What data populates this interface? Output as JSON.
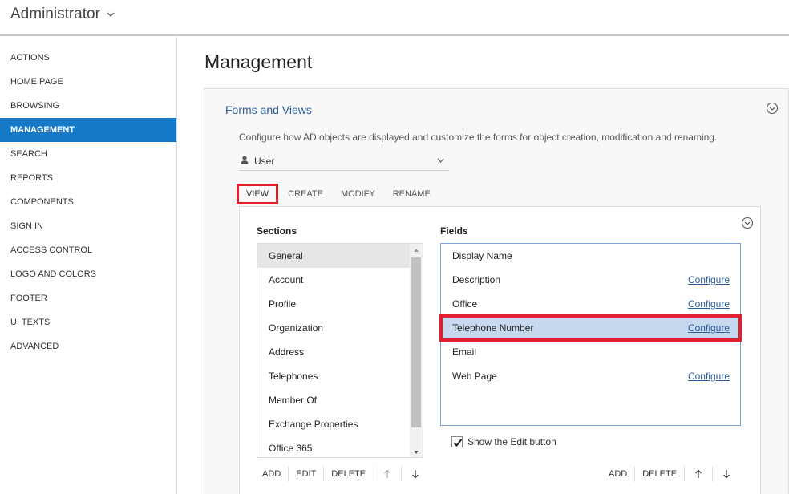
{
  "header": {
    "title": "Administrator"
  },
  "sidebar": {
    "items": [
      {
        "label": "ACTIONS"
      },
      {
        "label": "HOME PAGE"
      },
      {
        "label": "BROWSING"
      },
      {
        "label": "MANAGEMENT",
        "active": true
      },
      {
        "label": "SEARCH"
      },
      {
        "label": "REPORTS"
      },
      {
        "label": "COMPONENTS"
      },
      {
        "label": "SIGN IN"
      },
      {
        "label": "ACCESS CONTROL"
      },
      {
        "label": "LOGO AND COLORS"
      },
      {
        "label": "FOOTER"
      },
      {
        "label": "UI TEXTS"
      },
      {
        "label": "ADVANCED"
      }
    ]
  },
  "main": {
    "page_title": "Management",
    "card": {
      "title": "Forms and Views",
      "description": "Configure how AD objects are displayed and customize the forms for object creation, modification and renaming.",
      "object_type": {
        "selected": "User",
        "icon": "user-icon"
      },
      "tabs": [
        {
          "label": "VIEW",
          "active": true
        },
        {
          "label": "CREATE"
        },
        {
          "label": "MODIFY"
        },
        {
          "label": "RENAME"
        }
      ],
      "sections": {
        "label": "Sections",
        "items": [
          "General",
          "Account",
          "Profile",
          "Organization",
          "Address",
          "Telephones",
          "Member Of",
          "Exchange Properties",
          "Office 365"
        ],
        "selected_index": 0,
        "toolbar": {
          "add": "ADD",
          "edit": "EDIT",
          "delete": "DELETE"
        }
      },
      "fields": {
        "label": "Fields",
        "items": [
          {
            "name": "Display Name",
            "configure": ""
          },
          {
            "name": "Description",
            "configure": "Configure"
          },
          {
            "name": "Office",
            "configure": "Configure"
          },
          {
            "name": "Telephone Number",
            "configure": "Configure",
            "selected": true
          },
          {
            "name": "Email",
            "configure": ""
          },
          {
            "name": "Web Page",
            "configure": "Configure"
          }
        ],
        "show_edit_button": {
          "label": "Show the Edit button",
          "checked": true
        },
        "toolbar": {
          "add": "ADD",
          "delete": "DELETE"
        }
      }
    }
  },
  "colors": {
    "accent": "#1479c6",
    "highlight": "#e0202e",
    "selected_row": "#c7d9ee",
    "link": "#2a5d9a"
  }
}
